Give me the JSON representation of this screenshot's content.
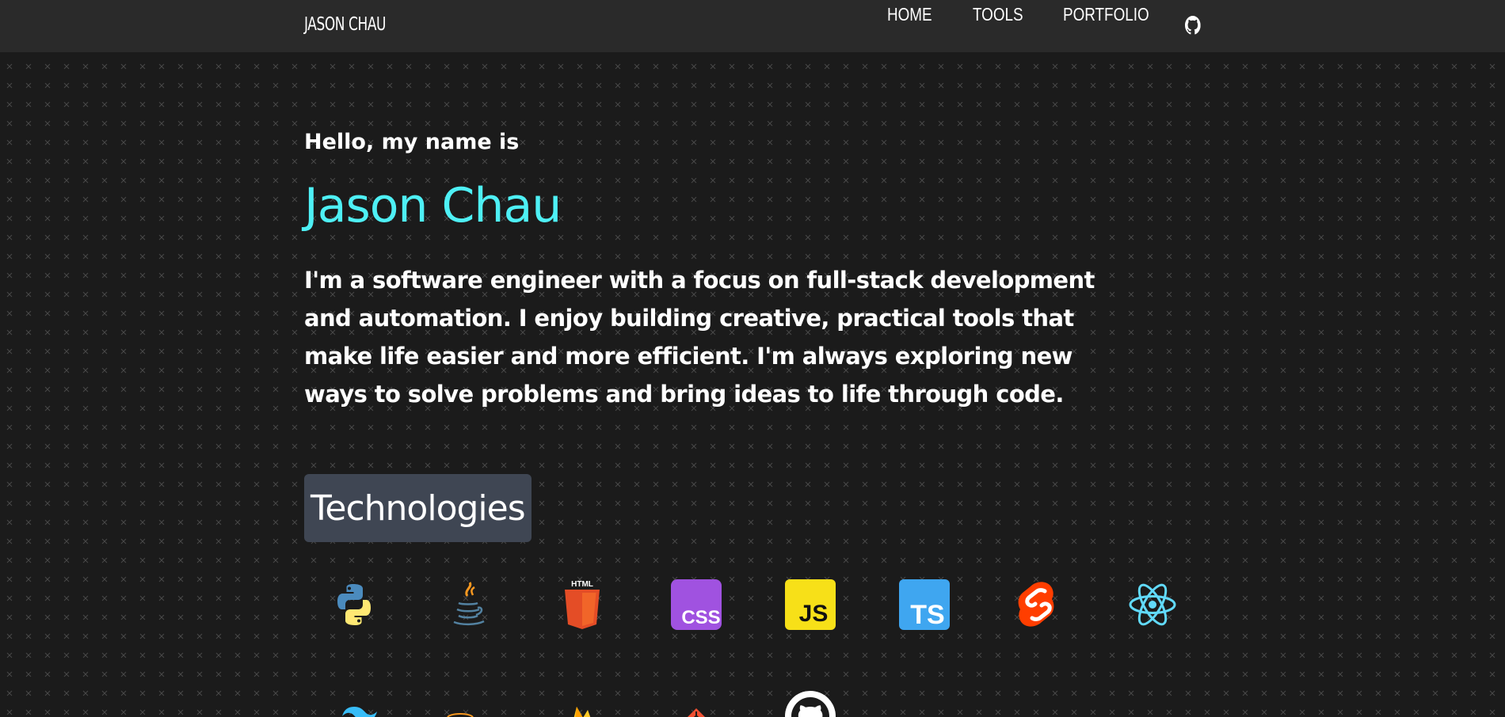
{
  "header": {
    "brand": "JASON CHAU",
    "nav": {
      "home": "HOME",
      "tools": "TOOLS",
      "portfolio": "PORTFOLIO",
      "github_icon": "github-icon"
    }
  },
  "hero": {
    "greeting": "Hello, my name is",
    "name": "Jason Chau",
    "bio": "I'm a software engineer with a focus on full-stack development and automation. I enjoy building creative, practical tools that make life easier and more efficient. I'm always exploring new ways to solve problems and bring ideas to life through code."
  },
  "technologies": {
    "heading": "Technologies",
    "row1": [
      {
        "name": "python-icon"
      },
      {
        "name": "java-icon"
      },
      {
        "name": "html5-icon",
        "label": "HTML",
        "glyph": "5"
      },
      {
        "name": "css-icon",
        "label": "CSS"
      },
      {
        "name": "javascript-icon",
        "label": "JS"
      },
      {
        "name": "typescript-icon",
        "label": "TS"
      },
      {
        "name": "svelte-icon"
      },
      {
        "name": "react-icon"
      }
    ],
    "row2": [
      {
        "name": "tailwind-icon"
      },
      {
        "name": "database-icon"
      },
      {
        "name": "firebase-icon"
      },
      {
        "name": "git-icon"
      },
      {
        "name": "github-icon"
      }
    ]
  },
  "colors": {
    "accent": "#4ef0f5",
    "topbar": "#2a2a2a",
    "background": "#1b1b1b",
    "heading_bg": "#3f4653"
  }
}
